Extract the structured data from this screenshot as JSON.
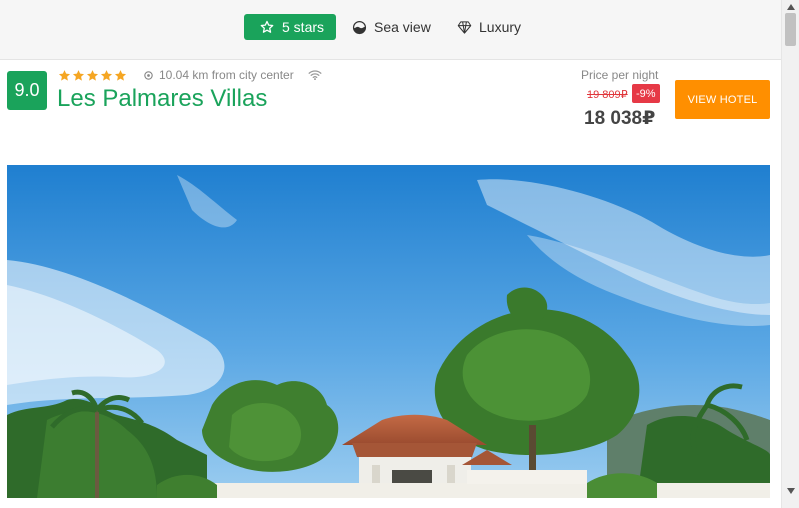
{
  "filters": {
    "five_stars": {
      "label": "5 stars",
      "icon": "star-outline-icon",
      "active": true
    },
    "sea_view": {
      "label": "Sea view",
      "icon": "sea-view-icon",
      "active": false
    },
    "luxury": {
      "label": "Luxury",
      "icon": "diamond-icon",
      "active": false
    }
  },
  "hotel": {
    "score": "9.0",
    "star_rating": 5,
    "distance": "10.04 km from city center",
    "name": "Les Palmares Villas",
    "amenity_icon": "wifi-icon"
  },
  "pricing": {
    "label": "Price per night",
    "old_price": "19 809₽",
    "discount": "-9%",
    "price": "18 038₽",
    "cta": "VIEW HOTEL"
  },
  "colors": {
    "brand_green": "#1aa35b",
    "cta_orange": "#ff8f00",
    "discount_red": "#e63946",
    "star_yellow": "#f5a623"
  }
}
